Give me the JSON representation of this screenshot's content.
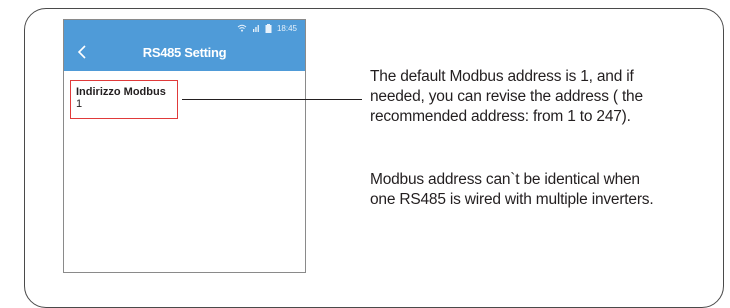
{
  "status_bar": {
    "time": "18:45",
    "icons": [
      "wifi-icon",
      "signal-icon",
      "battery-icon"
    ]
  },
  "app_bar": {
    "back_icon": "chevron-left-icon",
    "title": "RS485 Setting",
    "color": "#4f9bd8"
  },
  "modbus_field": {
    "label": "Indirizzo Modbus",
    "value": "1",
    "highlight_color": "#e03a3a"
  },
  "annotations": {
    "address_note": [
      "The default Modbus address is 1, and if",
      "needed, you can revise the address ( the",
      "recommended address: from 1 to 247)."
    ],
    "identical_note": [
      "Modbus address can`t be identical when",
      "one RS485 is wired with multiple inverters."
    ]
  }
}
